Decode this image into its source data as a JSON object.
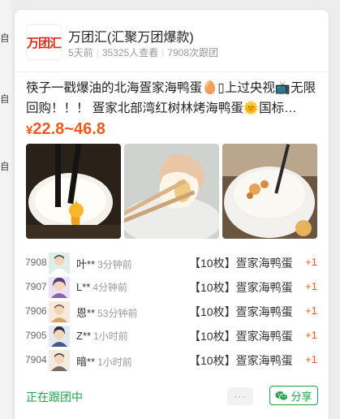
{
  "edge": {
    "chars": [
      "自",
      "自",
      "自"
    ]
  },
  "group": {
    "logo_text": "万团汇",
    "name": "万团汇(汇聚万团爆款)",
    "posted": "5天前",
    "views": "35325人查看",
    "follows": "7908次跟团"
  },
  "product": {
    "title": "筷子一戳爆油的北海疍家海鸭蛋🥚▯上过央视📺无限回购！！！ 疍家北部湾红树林烤海鸭蛋🌞国标…",
    "currency": "¥",
    "price_range": "22.8~46.8"
  },
  "orders": [
    {
      "num": "7908",
      "buyer": "叶**",
      "time": "3分钟前",
      "item": "【10枚】疍家海鸭蛋",
      "qty": "+1"
    },
    {
      "num": "7907",
      "buyer": "L**",
      "time": "4分钟前",
      "item": "【10枚】疍家海鸭蛋",
      "qty": "+1"
    },
    {
      "num": "7906",
      "buyer": "恩**",
      "time": "53分钟前",
      "item": "【10枚】疍家海鸭蛋",
      "qty": "+1"
    },
    {
      "num": "7905",
      "buyer": "Z**",
      "time": "1小时前",
      "item": "【10枚】疍家海鸭蛋",
      "qty": "+1"
    },
    {
      "num": "7904",
      "buyer": "暗**",
      "time": "1小时前",
      "item": "【10枚】疍家海鸭蛋",
      "qty": "+1"
    }
  ],
  "footer": {
    "status": "正在跟团中",
    "more": "···",
    "share": "分享"
  },
  "colors": {
    "accent_green": "#21a34a",
    "price_orange": "#f05a1a",
    "logo_red": "#e0261b"
  }
}
